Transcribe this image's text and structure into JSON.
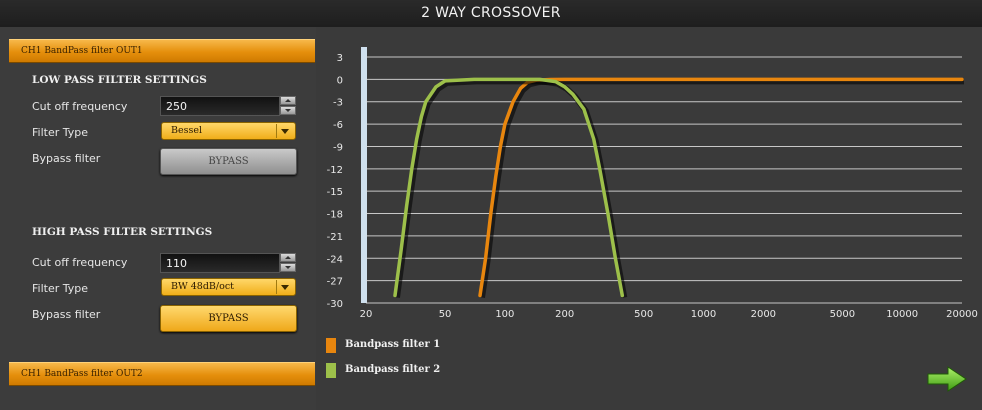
{
  "title": "2 WAY CROSSOVER",
  "channels": {
    "out1_label": "CH1 BandPass filter OUT1",
    "out2_label": "CH1 BandPass filter OUT2"
  },
  "low_pass": {
    "section_title": "LOW PASS FILTER SETTINGS",
    "cutoff_label": "Cut off frequency",
    "cutoff_value": "250",
    "filter_type_label": "Filter Type",
    "filter_type_value": "Bessel",
    "bypass_label": "Bypass filter",
    "bypass_button": "BYPASS"
  },
  "high_pass": {
    "section_title": "HIGH PASS FILTER SETTINGS",
    "cutoff_label": "Cut off frequency",
    "cutoff_value": "110",
    "filter_type_label": "Filter Type",
    "filter_type_value": "BW 48dB/oct",
    "bypass_label": "Bypass filter",
    "bypass_button": "BYPASS"
  },
  "chart_data": {
    "type": "line",
    "x_scale": "log",
    "xlim": [
      20,
      20000
    ],
    "ylim": [
      -30,
      3
    ],
    "x_ticks": [
      20,
      50,
      100,
      200,
      500,
      1000,
      2000,
      5000,
      10000,
      20000
    ],
    "x_tick_labels": [
      "20",
      "50",
      "100",
      "200",
      "500",
      "1000",
      "2000",
      "5000",
      "10000",
      "20000"
    ],
    "y_ticks": [
      3,
      0,
      -3,
      -6,
      -9,
      -12,
      -15,
      -18,
      -21,
      -24,
      -27,
      -30
    ],
    "y_tick_labels": [
      "3",
      "0",
      "-3",
      "-6",
      "-9",
      "-12",
      "-15",
      "-18",
      "-21",
      "-24",
      "-27",
      "-30"
    ],
    "grid": true,
    "legend_position": "bottom-left",
    "series": [
      {
        "name": "Bandpass filter 1",
        "color": "#e8860e",
        "x": [
          75,
          80,
          85,
          90,
          95,
          100,
          110,
          120,
          130,
          145,
          170,
          200,
          500,
          1000,
          5000,
          20000
        ],
        "y": [
          -29,
          -24,
          -18,
          -13,
          -9,
          -6,
          -3,
          -1.2,
          -0.4,
          -0.1,
          -0.02,
          0,
          0,
          0,
          0,
          0
        ]
      },
      {
        "name": "Bandpass filter 2",
        "color": "#9dc04a",
        "x": [
          28,
          30,
          32,
          34,
          36,
          38,
          40,
          45,
          50,
          70,
          100,
          150,
          180,
          200,
          220,
          250,
          280,
          300,
          330,
          360,
          390
        ],
        "y": [
          -29,
          -23,
          -17,
          -12,
          -8,
          -5,
          -3,
          -1,
          -0.2,
          0,
          0,
          0,
          -0.3,
          -1,
          -2,
          -4,
          -8,
          -12,
          -18,
          -24,
          -29
        ]
      }
    ]
  },
  "legend": {
    "item1": "Bandpass filter 1",
    "item2": "Bandpass filter 2",
    "color1": "#e8860e",
    "color2": "#9dc04a"
  },
  "nav": {
    "next_icon": "arrow-right-icon"
  }
}
